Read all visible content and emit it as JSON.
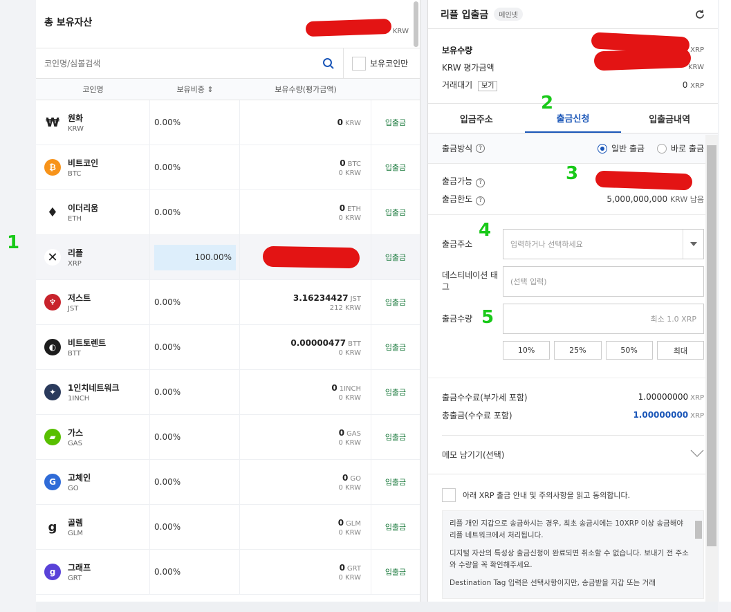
{
  "left": {
    "title": "총 보유자산",
    "total_unit": "KRW",
    "search_placeholder": "코인명/심볼검색",
    "own_only_label": "보유코인만",
    "col_name": "코인명",
    "col_ratio": "보유비중 ⇕",
    "col_amount": "보유수량(평가금액)",
    "rows": [
      {
        "name": "원화",
        "sym": "KRW",
        "ratio": "0.00%",
        "amt": "0",
        "amt_unit": "KRW",
        "sub": "",
        "act": "입출금",
        "icon_color": "#ffffff",
        "icon": "₩"
      },
      {
        "name": "비트코인",
        "sym": "BTC",
        "ratio": "0.00%",
        "amt": "0",
        "amt_unit": "BTC",
        "sub": "0 KRW",
        "act": "입출금",
        "icon_color": "#f7931a",
        "icon": "₿"
      },
      {
        "name": "이더리움",
        "sym": "ETH",
        "ratio": "0.00%",
        "amt": "0",
        "amt_unit": "ETH",
        "sub": "0 KRW",
        "act": "입출금",
        "icon_color": "#ffffff",
        "icon": "♦"
      },
      {
        "name": "리플",
        "sym": "XRP",
        "ratio": "100.00%",
        "amt": "",
        "amt_unit": "",
        "sub": "",
        "act": "입출금",
        "icon_color": "#ffffff",
        "icon": "✕"
      },
      {
        "name": "저스트",
        "sym": "JST",
        "ratio": "0.00%",
        "amt": "3.16234427",
        "amt_unit": "JST",
        "sub": "212 KRW",
        "act": "입출금",
        "icon_color": "#c8232c",
        "icon": "♆"
      },
      {
        "name": "비트토렌트",
        "sym": "BTT",
        "ratio": "0.00%",
        "amt": "0.00000477",
        "amt_unit": "BTT",
        "sub": "0 KRW",
        "act": "입출금",
        "icon_color": "#1c1c1c",
        "icon": "◐"
      },
      {
        "name": "1인치네트워크",
        "sym": "1INCH",
        "ratio": "0.00%",
        "amt": "0",
        "amt_unit": "1INCH",
        "sub": "0 KRW",
        "act": "입출금",
        "icon_color": "#2a3a5c",
        "icon": "✦"
      },
      {
        "name": "가스",
        "sym": "GAS",
        "ratio": "0.00%",
        "amt": "0",
        "amt_unit": "GAS",
        "sub": "0 KRW",
        "act": "입출금",
        "icon_color": "#58bf00",
        "icon": "▰"
      },
      {
        "name": "고체인",
        "sym": "GO",
        "ratio": "0.00%",
        "amt": "0",
        "amt_unit": "GO",
        "sub": "0 KRW",
        "act": "입출금",
        "icon_color": "#2f6bd7",
        "icon": "G"
      },
      {
        "name": "골렘",
        "sym": "GLM",
        "ratio": "0.00%",
        "amt": "0",
        "amt_unit": "GLM",
        "sub": "0 KRW",
        "act": "입출금",
        "icon_color": "#ffffff",
        "icon": "g"
      },
      {
        "name": "그래프",
        "sym": "GRT",
        "ratio": "0.00%",
        "amt": "0",
        "amt_unit": "GRT",
        "sub": "0 KRW",
        "act": "입출금",
        "icon_color": "#5942d8",
        "icon": "g"
      }
    ]
  },
  "right": {
    "title": "리플 입출금",
    "network_badge": "메인넷",
    "holding_label": "보유수량",
    "holding_unit": "XRP",
    "krw_label": "KRW 평가금액",
    "krw_unit": "KRW",
    "pending_label": "거래대기",
    "see_label": "보기",
    "pending_value": "0",
    "pending_unit": "XRP",
    "tabs": [
      "입금주소",
      "출금신청",
      "입출금내역"
    ],
    "method_label": "출금방식",
    "method_normal": "일반 출금",
    "method_instant": "바로 출금",
    "avail_label": "출금가능",
    "limit_label": "출금한도",
    "limit_value": "5,000,000,000",
    "limit_unit": "KRW 남음",
    "addr_label": "출금주소",
    "addr_placeholder": "입력하거나 선택하세요",
    "tag_label": "데스티네이션 태그",
    "tag_placeholder": "(선택 입력)",
    "qty_label": "출금수량",
    "qty_placeholder": "최소 1.0 XRP",
    "pct": [
      "10%",
      "25%",
      "50%",
      "최대"
    ],
    "fee_label": "출금수수료(부가세 포함)",
    "fee_value": "1.00000000",
    "fee_unit": "XRP",
    "total_label": "총출금(수수료 포함)",
    "total_value": "1.00000000",
    "total_unit": "XRP",
    "memo_label": "메모 남기기(선택)",
    "agree_label": "아래 XRP 출금 안내 및 주의사항을 읽고 동의합니다.",
    "notice": [
      "리플 개인 지갑으로 송금하시는 경우, 최초 송금시에는 10XRP 이상 송금해야 리플 네트워크에서 처리됩니다.",
      "디지털 자산의 특성상 출금신청이 완료되면 취소할 수 없습니다. 보내기 전 주소와 수량을 꼭 확인해주세요.",
      "Destination Tag 입력은 선택사항이지만, 송금받을 지갑 또는 거래"
    ]
  },
  "annotations": [
    "1",
    "2",
    "3",
    "4",
    "5"
  ]
}
